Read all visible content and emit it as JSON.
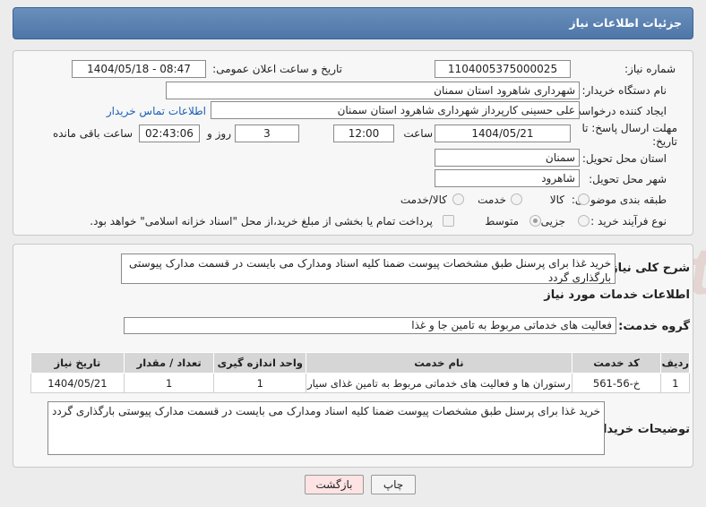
{
  "header": {
    "title": "جزئیات اطلاعات نیاز"
  },
  "form": {
    "need_number_label": "شماره نیاز:",
    "need_number": "1104005375000025",
    "announce_label": "تاریخ و ساعت اعلان عمومی:",
    "announce_value": "1404/05/18 - 08:47",
    "buyer_org_label": "نام دستگاه خریدار:",
    "buyer_org": "شهرداری شاهرود استان سمنان",
    "requester_label": "ایجاد کننده درخواست:",
    "requester": "علی حسینی کارپرداز شهرداری شاهرود استان سمنان",
    "contact_link": "اطلاعات تماس خریدار",
    "deadline_label_line1": "مهلت ارسال پاسخ: تا",
    "deadline_label_line2": "تاریخ:",
    "deadline_date": "1404/05/21",
    "time_label": "ساعت",
    "deadline_time": "12:00",
    "days_value": "3",
    "days_label": "روز و",
    "remaining_time": "02:43:06",
    "remaining_label": "ساعت باقی مانده",
    "province_label": "استان محل تحویل:",
    "province": "سمنان",
    "city_label": "شهر محل تحویل:",
    "city": "شاهرود",
    "category_label": "طبقه بندی موضوعی:",
    "category_options": [
      "کالا",
      "خدمت",
      "کالا/خدمت"
    ],
    "category_selected": "خدمت",
    "process_label": "نوع فرآیند خرید :",
    "process_options": [
      "جزیی",
      "متوسط"
    ],
    "process_selected": "متوسط",
    "payment_note": "پرداخت تمام یا بخشی از مبلغ خرید،از محل \"اسناد خزانه اسلامی\" خواهد بود."
  },
  "summary": {
    "label": "شرح کلی نیاز:",
    "text": "خرید غذا برای پرسنل طبق مشخصات پیوست ضمنا کلیه اسناد ومدارک می بایست در قسمت مدارک پیوستی بارگذاری گردد"
  },
  "services": {
    "section_title": "اطلاعات خدمات مورد نیاز",
    "group_label": "گروه خدمت:",
    "group_value": "فعالیت های خدماتی مربوط به تامین جا و غذا",
    "columns": [
      "ردیف",
      "کد خدمت",
      "نام خدمت",
      "واحد اندازه گیری",
      "تعداد / مقدار",
      "تاریخ نیاز"
    ],
    "rows": [
      [
        "1",
        "خ-56-561",
        "رستوران ها و فعالیت های خدماتی مربوط به تامین غذای سیار",
        "1",
        "1",
        "1404/05/21"
      ]
    ]
  },
  "buyer_notes": {
    "label": "توضیحات خریدار:",
    "text": "خرید غذا برای پرسنل طبق مشخصات پیوست ضمنا کلیه اسناد ومدارک می بایست در قسمت مدارک پیوستی بارگذاری گردد"
  },
  "buttons": {
    "print": "چاپ",
    "back": "بازگشت"
  },
  "watermark": {
    "text": "AriaTender.net"
  },
  "colors": {
    "header": "#5a80b0",
    "back_button": "#fde3e3",
    "link": "#1a5fb4"
  }
}
